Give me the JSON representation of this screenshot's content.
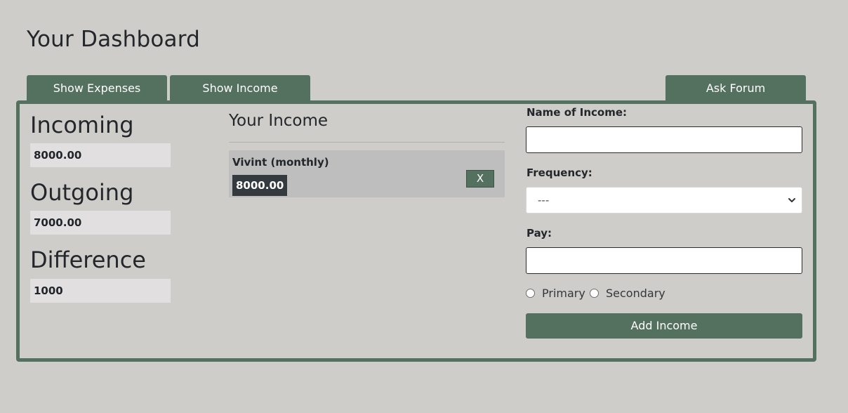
{
  "header": {
    "title": "Your Dashboard"
  },
  "tabs": {
    "expenses": "Show Expenses",
    "income": "Show Income",
    "forum": "Ask Forum"
  },
  "summary": {
    "incoming_label": "Incoming",
    "incoming_value": "8000.00",
    "outgoing_label": "Outgoing",
    "outgoing_value": "7000.00",
    "difference_label": "Difference",
    "difference_value": "1000"
  },
  "income_list": {
    "heading": "Your Income",
    "items": [
      {
        "name": "Vivint (monthly)",
        "amount": "8000.00",
        "delete_label": "X"
      }
    ]
  },
  "form": {
    "name_label": "Name of Income:",
    "name_value": "",
    "frequency_label": "Frequency:",
    "frequency_selected": "---",
    "pay_label": "Pay:",
    "pay_value": "",
    "radio_primary": "Primary",
    "radio_secondary": "Secondary",
    "submit_label": "Add Income"
  },
  "icons": {
    "chevron": "chevron-down-icon"
  },
  "colors": {
    "accent": "#54705f",
    "background": "#cfcdc9",
    "value_box": "#e1dfdf",
    "amount_badge": "#343a40"
  }
}
